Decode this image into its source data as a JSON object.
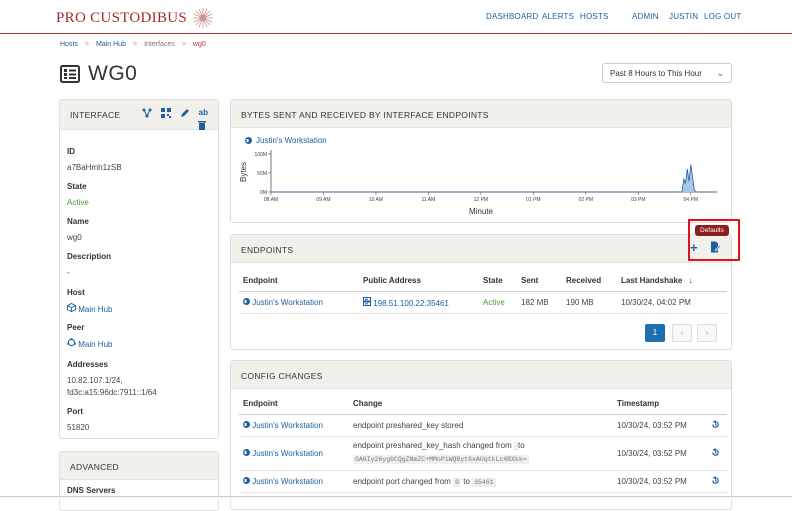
{
  "brand": {
    "name": "PRO CUSTODIBUS"
  },
  "nav": {
    "dashboard": "DASHBOARD",
    "alerts": "ALERTS",
    "hosts": "HOSTS",
    "admin": "ADMIN",
    "user": "JUSTIN",
    "logout": "LOG OUT"
  },
  "breadcrumb": {
    "hosts": "Hosts",
    "sep": ">",
    "main_hub": "Main Hub",
    "interfaces": "Interfaces",
    "current": "wg0"
  },
  "page": {
    "title": "WG0"
  },
  "timerange": {
    "selected": "Past 8 Hours to This Hour"
  },
  "interface_panel": {
    "title": "INTERFACE",
    "fields": {
      "id_label": "ID",
      "id_value": "a7BaHmh1zSB",
      "state_label": "State",
      "state_value": "Active",
      "name_label": "Name",
      "name_value": "wg0",
      "description_label": "Description",
      "description_value": "-",
      "host_label": "Host",
      "host_value": "Main Hub",
      "peer_label": "Peer",
      "peer_value": "Main Hub",
      "addresses_label": "Addresses",
      "addresses_value_1": "10.82.107.1/24,",
      "addresses_value_2": "fd3c:a15:96dc:7911::1/64",
      "port_label": "Port",
      "port_value": "51820"
    }
  },
  "advanced_panel": {
    "title": "ADVANCED",
    "dns_label": "DNS Servers"
  },
  "bytes_panel": {
    "title": "BYTES SENT AND RECEIVED BY INTERFACE ENDPOINTS"
  },
  "chart_data": {
    "type": "area",
    "title": "",
    "xlabel": "Minute",
    "ylabel": "Bytes",
    "y_ticks": [
      "100M",
      "50M",
      "0M"
    ],
    "x_ticks": [
      "08 AM",
      "09 AM",
      "10 AM",
      "11 AM",
      "12 PM",
      "01 PM",
      "02 PM",
      "03 PM",
      "04 PM"
    ],
    "ylim": [
      0,
      110
    ],
    "series": [
      {
        "name": "Justin's Workstation",
        "x": [
          "08:00",
          "15:45",
          "15:50",
          "15:52",
          "15:54",
          "15:56",
          "15:58",
          "16:00",
          "16:02",
          "16:04",
          "16:06",
          "16:08",
          "16:30"
        ],
        "values": [
          0,
          0,
          0,
          35,
          22,
          60,
          28,
          72,
          40,
          5,
          0,
          0,
          0
        ]
      }
    ],
    "colors": {
      "fill": "#a9c8e6",
      "stroke": "#1f5fa0"
    }
  },
  "endpoints_panel": {
    "title": "ENDPOINTS",
    "tooltip": "Defaults",
    "columns": [
      "Endpoint",
      "Public Address",
      "State",
      "Sent",
      "Received",
      "Last Handshake"
    ],
    "sort_indicator": "↓",
    "rows": [
      {
        "endpoint": "Justin's Workstation",
        "address": "198.51.100.22:35461",
        "state": "Active",
        "sent": "182 MB",
        "received": "190 MB",
        "handshake": "10/30/24, 04:02 PM"
      }
    ],
    "pager": {
      "page": "1",
      "prev": "‹",
      "next": "›"
    }
  },
  "config_panel": {
    "title": "CONFIG CHANGES",
    "columns": [
      "Endpoint",
      "Change",
      "Timestamp"
    ],
    "rows": [
      {
        "endpoint": "Justin's Workstation",
        "change": "endpoint preshared_key stored",
        "timestamp": "10/30/24, 03:52 PM"
      },
      {
        "endpoint": "Justin's Workstation",
        "change_prefix": "endpoint preshared_key_hash changed from",
        "change_to": "to",
        "change_code": "GA6Iy26ygbCQgZNmZC+MMoP1WQByt6xAUqtkLc4BXkk=",
        "timestamp": "10/30/24, 03:52 PM"
      },
      {
        "endpoint": "Justin's Workstation",
        "change_prefix": "endpoint port changed from",
        "from_code": "0",
        "change_to": "to",
        "to_code": "35461",
        "timestamp": "10/30/24, 03:52 PM"
      }
    ]
  }
}
